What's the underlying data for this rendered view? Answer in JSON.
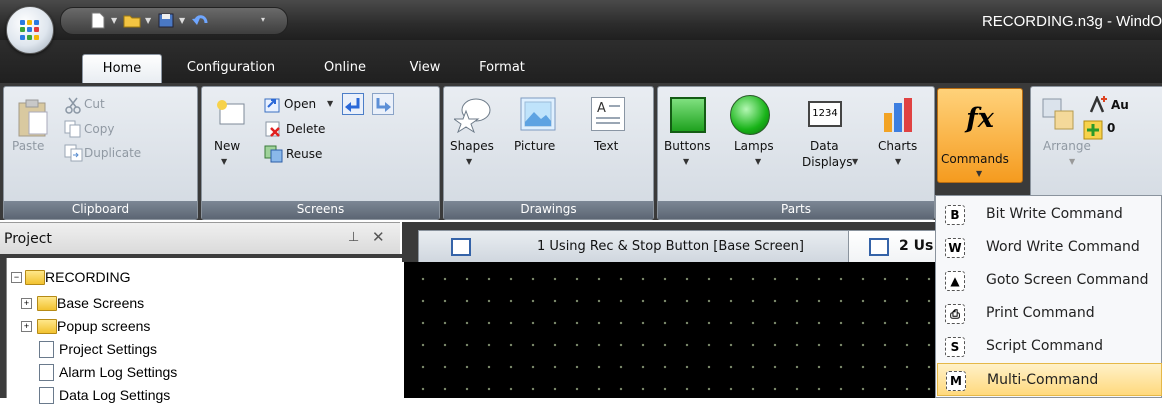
{
  "window": {
    "title": "RECORDING.n3g - WindO"
  },
  "ribbon_tabs": [
    "Home",
    "Configuration",
    "Online",
    "View",
    "Format"
  ],
  "groups": {
    "clipboard": {
      "label": "Clipboard",
      "paste": "Paste",
      "cut": "Cut",
      "copy": "Copy",
      "duplicate": "Duplicate"
    },
    "screens": {
      "label": "Screens",
      "new": "New",
      "open": "Open",
      "delete": "Delete",
      "reuse": "Reuse"
    },
    "drawings": {
      "label": "Drawings",
      "shapes": "Shapes",
      "picture": "Picture",
      "text": "Text",
      "text_icon": "A"
    },
    "parts": {
      "label": "Parts",
      "buttons": "Buttons",
      "lamps": "Lamps",
      "data_displays_1": "Data",
      "data_displays_2": "Displays",
      "data_icon": "1234",
      "charts": "Charts",
      "commands": "Commands",
      "commands_icon": "fx"
    },
    "arrange": {
      "arrange": "Arrange",
      "auto": "Au",
      "count": "0"
    }
  },
  "project": {
    "title": "Project",
    "tree": [
      "RECORDING",
      "Base Screens",
      "Popup screens",
      "Project Settings",
      "Alarm Log Settings",
      "Data Log Settings"
    ]
  },
  "document_tabs": [
    "1 Using Rec & Stop Button [Base Screen]",
    "2 Us"
  ],
  "commands_menu": [
    {
      "icon": "B",
      "label": "Bit Write Command"
    },
    {
      "icon": "W",
      "label": "Word Write Command"
    },
    {
      "icon": "▲",
      "label": "Goto Screen Command"
    },
    {
      "icon": "⎙",
      "label": "Print Command"
    },
    {
      "icon": "S",
      "label": "Script Command"
    },
    {
      "icon": "M",
      "label": "Multi-Command"
    }
  ],
  "colors": {
    "accent": "#ffd97d",
    "ribbon_label": "#6b7582",
    "canvas": "#000000"
  }
}
